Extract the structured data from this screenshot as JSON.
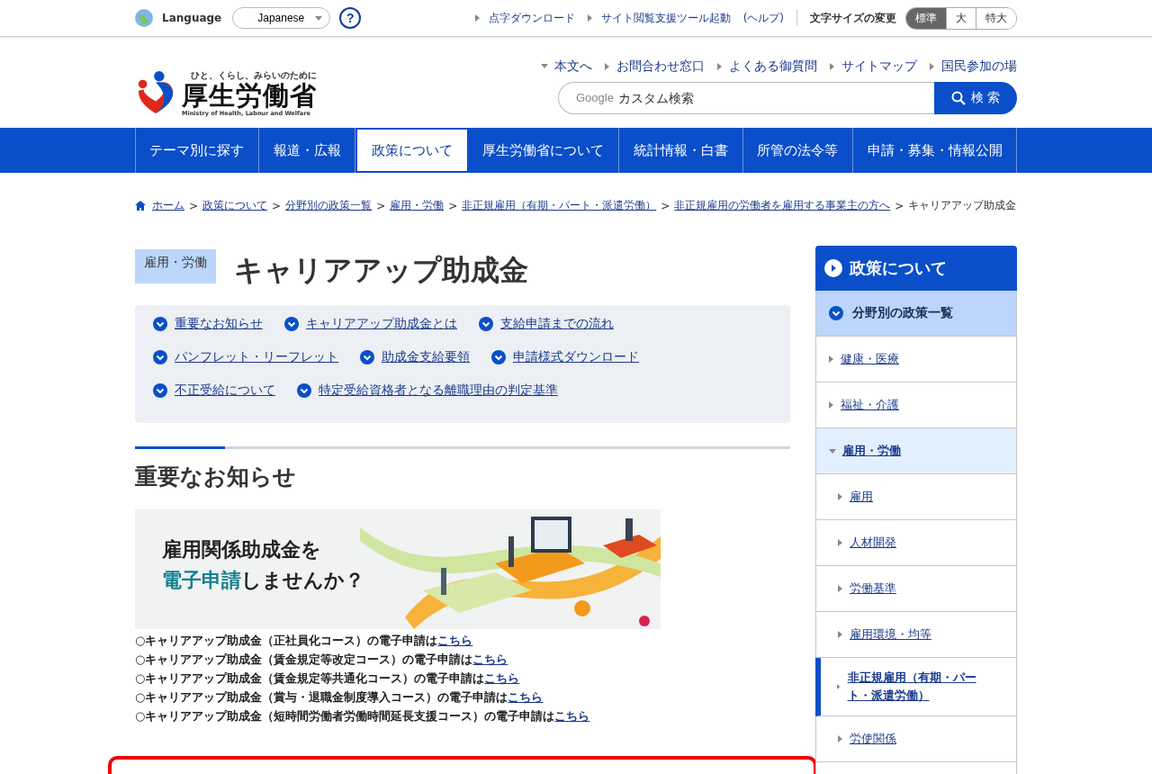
{
  "utility_bar": {
    "language_label": "Language",
    "language_select": "Japanese",
    "help": "?",
    "links": [
      "点字ダウンロード",
      "サイト閲覧支援ツール起動",
      "(ヘルプ)"
    ],
    "font_size_label": "文字サイズの変更",
    "font_sizes": [
      {
        "label": "標準",
        "selected": true
      },
      {
        "label": "大",
        "selected": false
      },
      {
        "label": "特大",
        "selected": false
      }
    ]
  },
  "header": {
    "logo": {
      "tagline": "ひと、くらし、みらいのために",
      "name": "厚生労働省",
      "english": "Ministry of Health, Labour and Welfare"
    },
    "links": [
      {
        "label": "本文へ",
        "kind": "down"
      },
      {
        "label": "お問合わせ窓口",
        "kind": "right"
      },
      {
        "label": "よくある御質問",
        "kind": "right"
      },
      {
        "label": "サイトマップ",
        "kind": "right"
      },
      {
        "label": "国民参加の場",
        "kind": "right"
      }
    ],
    "search": {
      "brand": "Google",
      "placeholder": "カスタム検索",
      "button": "検 索"
    }
  },
  "nav": [
    {
      "label": "テーマ別に探す",
      "selected": false
    },
    {
      "label": "報道・広報",
      "selected": false
    },
    {
      "label": "政策について",
      "selected": true
    },
    {
      "label": "厚生労働省について",
      "selected": false
    },
    {
      "label": "統計情報・白書",
      "selected": false
    },
    {
      "label": "所管の法令等",
      "selected": false
    },
    {
      "label": "申請・募集・情報公開",
      "selected": false
    }
  ],
  "breadcrumb": {
    "links": [
      {
        "label": "ホーム",
        "separator": ">"
      },
      {
        "label": "政策について",
        "separator": ">"
      },
      {
        "label": "分野別の政策一覧",
        "separator": ">"
      },
      {
        "label": "雇用・労働",
        "separator": ">"
      },
      {
        "label": "非正規雇用（有期・パート・派遣労働）",
        "separator": ">"
      },
      {
        "label": "非正規雇用の労働者を雇用する事業主の方へ",
        "separator": ">"
      }
    ],
    "current": "キャリアアップ助成金"
  },
  "page": {
    "category": "雇用・労働",
    "title": "キャリアアップ助成金",
    "anchors": [
      [
        "重要なお知らせ",
        "キャリアアップ助成金とは",
        "支給申請までの流れ"
      ],
      [
        "パンフレット・リーフレット",
        "助成金支給要領",
        "申請様式ダウンロード"
      ],
      [
        "不正受給について",
        "特定受給資格者となる離職理由の判定基準"
      ]
    ],
    "section_title": "重要なお知らせ",
    "banner": {
      "line_1": "雇用関係助成金を",
      "line_2_highlight": "電子申請",
      "line_2_rest": "しませんか？"
    },
    "notices": [
      {
        "text": "○キャリアアップ助成金（正社員化コース）の電子申請は",
        "link": "こちら"
      },
      {
        "text": "○キャリアアップ助成金（賃金規定等改定コース）の電子申請は",
        "link": "こちら"
      },
      {
        "text": "○キャリアアップ助成金（賃金規定等共通化コース）の電子申請は",
        "link": "こちら"
      },
      {
        "text": "○キャリアアップ助成金（賞与・退職金制度導入コース）の電子申請は",
        "link": "こちら"
      },
      {
        "text": "○キャリアアップ助成金（短時間労働者労働時間延長支援コース）の電子申請は",
        "link": "こちら"
      }
    ]
  },
  "sidebar": {
    "title": "政策について",
    "items": [
      {
        "label": "分野別の政策一覧",
        "expanded": true,
        "children": [
          {
            "label": "健康・医療",
            "expanded": false,
            "selected": false
          },
          {
            "label": "福祉・介護",
            "expanded": false,
            "selected": false
          },
          {
            "label": "雇用・労働",
            "expanded": true,
            "selected": false,
            "children": [
              {
                "label": "雇用",
                "selected": false
              },
              {
                "label": "人材開発",
                "selected": false
              },
              {
                "label": "労働基準",
                "selected": false
              },
              {
                "label": "雇用環境・均等",
                "selected": false
              },
              {
                "label": "非正規雇用（有期・パート・派遣労働）",
                "selected": true
              },
              {
                "label": "労使関係",
                "selected": false
              }
            ]
          }
        ]
      }
    ]
  }
}
